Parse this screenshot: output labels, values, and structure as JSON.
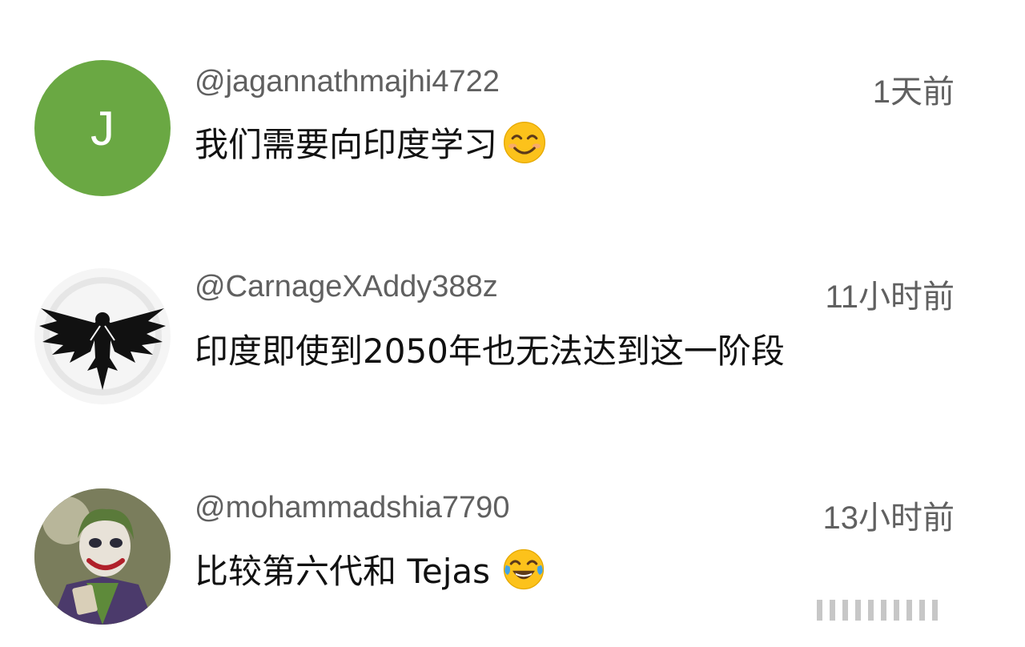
{
  "comments": [
    {
      "handle": "@jagannathmajhi4722",
      "time": "1天前",
      "text": "我们需要向印度学习",
      "avatar": {
        "type": "letter",
        "letter": "J",
        "color": "#6aa843"
      },
      "emoji": "smiling-face-icon"
    },
    {
      "handle": "@CarnageXAddy388z",
      "time": "11小时前",
      "text": "印度即使到2050年也无法达到这一阶段",
      "avatar": {
        "type": "image",
        "icon": "eagle-emblem-icon"
      }
    },
    {
      "handle": "@mohammadshia7790",
      "time": "13小时前",
      "text": "比较第六代和 Tejas",
      "avatar": {
        "type": "image",
        "icon": "joker-portrait-icon"
      },
      "emoji": "face-with-tears-of-joy-icon"
    }
  ],
  "colors": {
    "handle": "#606060",
    "time": "#606060",
    "text": "#111111",
    "letter_avatar": "#6aa843"
  }
}
